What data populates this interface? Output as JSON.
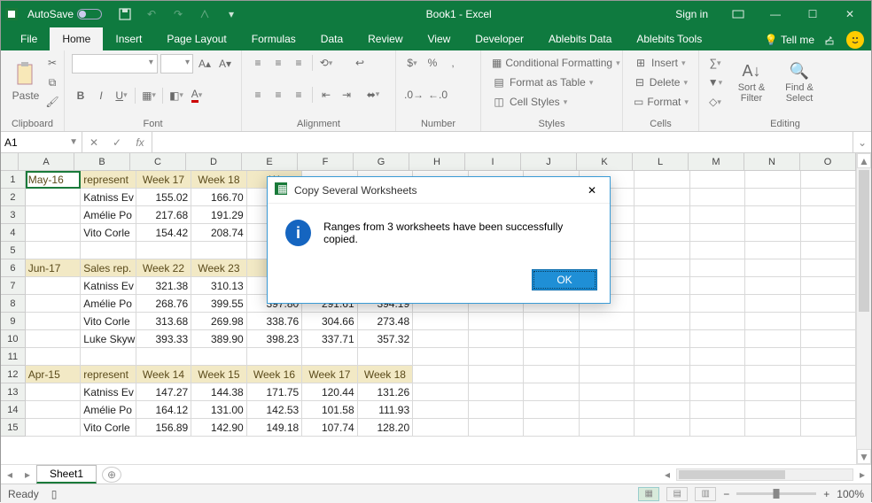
{
  "titlebar": {
    "autosave_label": "AutoSave",
    "title": "Book1 - Excel",
    "signin": "Sign in"
  },
  "tabs": {
    "file": "File",
    "home": "Home",
    "insert": "Insert",
    "page_layout": "Page Layout",
    "formulas": "Formulas",
    "data": "Data",
    "review": "Review",
    "view": "View",
    "developer": "Developer",
    "ablebits_data": "Ablebits Data",
    "ablebits_tools": "Ablebits Tools",
    "tell_me": "Tell me"
  },
  "ribbon": {
    "clipboard": {
      "label": "Clipboard",
      "paste": "Paste"
    },
    "font": {
      "label": "Font",
      "bold": "B",
      "italic": "I",
      "underline": "U"
    },
    "alignment": {
      "label": "Alignment"
    },
    "number": {
      "label": "Number"
    },
    "styles": {
      "label": "Styles",
      "conditional": "Conditional Formatting",
      "table": "Format as Table",
      "cell": "Cell Styles"
    },
    "cells": {
      "label": "Cells",
      "insert": "Insert",
      "delete": "Delete",
      "format": "Format"
    },
    "editing": {
      "label": "Editing",
      "sort": "Sort & Filter",
      "find": "Find & Select"
    }
  },
  "fx": {
    "namebox": "A1",
    "fx": "fx"
  },
  "columns": [
    "A",
    "B",
    "C",
    "D",
    "E",
    "F",
    "G",
    "H",
    "I",
    "J",
    "K",
    "L",
    "M",
    "N",
    "O"
  ],
  "sheet": {
    "rows": [
      {
        "n": 1,
        "header": true,
        "cells": [
          "May-16",
          "represent",
          "Week 17",
          "Week 18",
          "W",
          "",
          "",
          "",
          "",
          "",
          "",
          "",
          "",
          "",
          ""
        ]
      },
      {
        "n": 2,
        "cells": [
          "",
          "Katniss Ev",
          "155.02",
          "166.70",
          "",
          "",
          "",
          "",
          "",
          "",
          "",
          "",
          "",
          "",
          ""
        ],
        "num": [
          2,
          3
        ]
      },
      {
        "n": 3,
        "cells": [
          "",
          "Amélie Po",
          "217.68",
          "191.29",
          "",
          "",
          "",
          "",
          "",
          "",
          "",
          "",
          "",
          "",
          ""
        ],
        "num": [
          2,
          3
        ]
      },
      {
        "n": 4,
        "cells": [
          "",
          "Vito Corle",
          "154.42",
          "208.74",
          "",
          "",
          "",
          "",
          "",
          "",
          "",
          "",
          "",
          "",
          ""
        ],
        "num": [
          2,
          3
        ]
      },
      {
        "n": 5,
        "cells": [
          "",
          "",
          "",
          "",
          "",
          "",
          "",
          "",
          "",
          "",
          "",
          "",
          "",
          "",
          ""
        ]
      },
      {
        "n": 6,
        "header": true,
        "cells": [
          "Jun-17",
          "Sales rep.",
          "Week 22",
          "Week 23",
          "W",
          "",
          "",
          "",
          "",
          "",
          "",
          "",
          "",
          "",
          ""
        ]
      },
      {
        "n": 7,
        "cells": [
          "",
          "Katniss Ev",
          "321.38",
          "310.13",
          "",
          "",
          "",
          "",
          "",
          "",
          "",
          "",
          "",
          "",
          ""
        ],
        "num": [
          2,
          3
        ]
      },
      {
        "n": 8,
        "cells": [
          "",
          "Amélie Po",
          "268.76",
          "399.55",
          "397.80",
          "291.61",
          "394.19",
          "",
          "",
          "",
          "",
          "",
          "",
          "",
          ""
        ],
        "num": [
          2,
          3,
          4,
          5,
          6
        ]
      },
      {
        "n": 9,
        "cells": [
          "",
          "Vito Corle",
          "313.68",
          "269.98",
          "338.76",
          "304.66",
          "273.48",
          "",
          "",
          "",
          "",
          "",
          "",
          "",
          ""
        ],
        "num": [
          2,
          3,
          4,
          5,
          6
        ]
      },
      {
        "n": 10,
        "cells": [
          "",
          "Luke Skyw",
          "393.33",
          "389.90",
          "398.23",
          "337.71",
          "357.32",
          "",
          "",
          "",
          "",
          "",
          "",
          "",
          ""
        ],
        "num": [
          2,
          3,
          4,
          5,
          6
        ]
      },
      {
        "n": 11,
        "cells": [
          "",
          "",
          "",
          "",
          "",
          "",
          "",
          "",
          "",
          "",
          "",
          "",
          "",
          "",
          ""
        ]
      },
      {
        "n": 12,
        "header": true,
        "cells": [
          "Apr-15",
          "represent",
          "Week 14",
          "Week 15",
          "Week 16",
          "Week 17",
          "Week 18",
          "",
          "",
          "",
          "",
          "",
          "",
          "",
          ""
        ]
      },
      {
        "n": 13,
        "cells": [
          "",
          "Katniss Ev",
          "147.27",
          "144.38",
          "171.75",
          "120.44",
          "131.26",
          "",
          "",
          "",
          "",
          "",
          "",
          "",
          ""
        ],
        "num": [
          2,
          3,
          4,
          5,
          6
        ]
      },
      {
        "n": 14,
        "cells": [
          "",
          "Amélie Po",
          "164.12",
          "131.00",
          "142.53",
          "101.58",
          "111.93",
          "",
          "",
          "",
          "",
          "",
          "",
          "",
          ""
        ],
        "num": [
          2,
          3,
          4,
          5,
          6
        ]
      },
      {
        "n": 15,
        "cells": [
          "",
          "Vito Corle",
          "156.89",
          "142.90",
          "149.18",
          "107.74",
          "128.20",
          "",
          "",
          "",
          "",
          "",
          "",
          "",
          ""
        ],
        "num": [
          2,
          3,
          4,
          5,
          6
        ]
      }
    ]
  },
  "sheetbar": {
    "sheet1": "Sheet1"
  },
  "status": {
    "ready": "Ready",
    "zoom": "100%"
  },
  "dialog": {
    "title": "Copy Several Worksheets",
    "message": "Ranges from 3 worksheets have been successfully copied.",
    "ok": "OK"
  }
}
